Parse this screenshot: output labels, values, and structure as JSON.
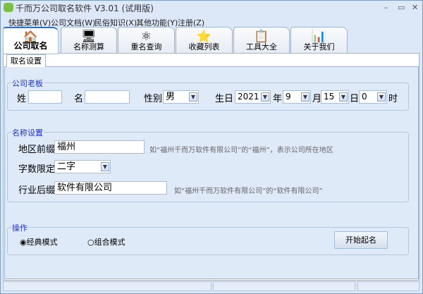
{
  "window": {
    "title": "千而万公司取名软件 V3.01 (试用版)",
    "minimize": "–",
    "maximize": "▭",
    "close": "✕"
  },
  "menu": [
    "快捷菜单(V)",
    "公司文档(W)",
    "民俗知识(X)",
    "其他功能(Y)",
    "注册(Z)"
  ],
  "tabs": [
    {
      "label": "公司取名",
      "icon": "house-icon",
      "glyph": "🏠"
    },
    {
      "label": "名称测算",
      "icon": "monitor-user-icon",
      "glyph": "🖥"
    },
    {
      "label": "重名查询",
      "icon": "molecule-icon",
      "glyph": "⚛"
    },
    {
      "label": "收藏列表",
      "icon": "star-icon",
      "glyph": "⭐"
    },
    {
      "label": "工具大全",
      "icon": "clipboard-icon",
      "glyph": "📋"
    },
    {
      "label": "关于我们",
      "icon": "chart-icon",
      "glyph": "📊"
    }
  ],
  "subtab": "取名设置",
  "boss": {
    "legend": "公司老板",
    "surname_label": "姓",
    "surname": "",
    "name_label": "名",
    "name": "",
    "gender_label": "性别",
    "gender": "男",
    "birthday_label": "生日",
    "year": "2021",
    "year_unit": "年",
    "month": "9",
    "month_unit": "月",
    "day": "15",
    "day_unit": "日",
    "hour": "0",
    "hour_unit": "时"
  },
  "naming": {
    "legend": "名称设置",
    "region_label": "地区前缀",
    "region": "福州",
    "region_hint": "如“福州千而万软件有限公司”的“福州”，表示公司所在地区",
    "length_label": "字数限定",
    "length": "二字",
    "suffix_label": "行业后缀",
    "suffix": "软件有限公司",
    "suffix_hint": "如“福州千而万软件有限公司”的“软件有限公司”"
  },
  "ops": {
    "legend": "操作",
    "mode1": "经典模式",
    "mode2": "组合模式",
    "selected_mode": "经典模式",
    "start": "开始起名"
  }
}
